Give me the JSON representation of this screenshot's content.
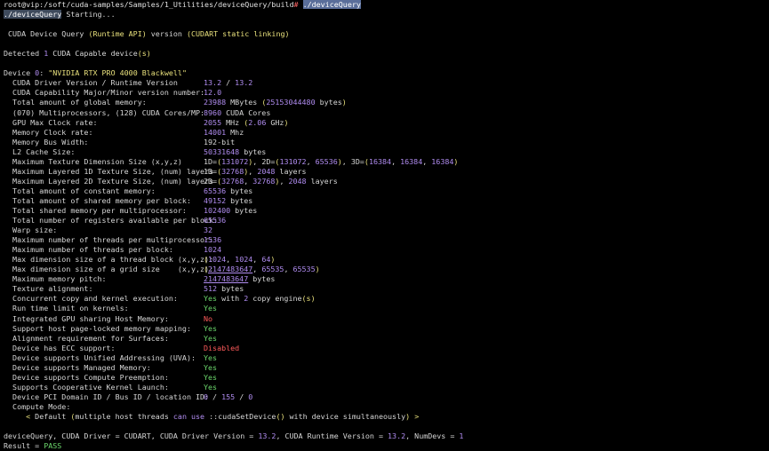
{
  "prompt": {
    "user_host_path": "root@vip:/soft/cuda-samples/Samples/1_Utilities/deviceQuery/build",
    "dollar": "#",
    "command": "./deviceQuery"
  },
  "starting": {
    "path": "./deviceQuery",
    "text": " Starting..."
  },
  "header": {
    "pre": " CUDA Device Query ",
    "paren1": "(Runtime API)",
    "mid": " version ",
    "paren2": "(CUDART static linking)"
  },
  "detected": {
    "pre": "Detected ",
    "count": "1",
    "mid": " CUDA Capable device",
    "suffix": "(s)"
  },
  "device": {
    "pre": "Device ",
    "index": "0",
    "colon": ": ",
    "name": "\"NVIDIA RTX PRO 4000 Blackwell\""
  },
  "rows": [
    {
      "key": "  CUDA Driver Version / Runtime Version",
      "parts": [
        {
          "t": "13.2",
          "c": "num"
        },
        {
          "t": " / ",
          "c": "gray"
        },
        {
          "t": "13.2",
          "c": "num"
        }
      ]
    },
    {
      "key": "  CUDA Capability Major/Minor version number:",
      "parts": [
        {
          "t": "12.0",
          "c": "num"
        }
      ]
    },
    {
      "key": "  Total amount of global memory:",
      "parts": [
        {
          "t": "23988",
          "c": "num"
        },
        {
          "t": " MBytes ",
          "c": "gray"
        },
        {
          "t": "(",
          "c": "paren"
        },
        {
          "t": "25153044480",
          "c": "num"
        },
        {
          "t": " bytes",
          "c": "gray"
        },
        {
          "t": ")",
          "c": "paren"
        }
      ]
    },
    {
      "key": "  (070) Multiprocessors, (128) CUDA Cores/MP:",
      "parts": [
        {
          "t": "8960",
          "c": "num"
        },
        {
          "t": " CUDA Cores",
          "c": "gray"
        }
      ]
    },
    {
      "key": "  GPU Max Clock rate:",
      "parts": [
        {
          "t": "2055",
          "c": "num"
        },
        {
          "t": " MHz ",
          "c": "gray"
        },
        {
          "t": "(",
          "c": "paren"
        },
        {
          "t": "2.06",
          "c": "num"
        },
        {
          "t": " GHz",
          "c": "gray"
        },
        {
          "t": ")",
          "c": "paren"
        }
      ]
    },
    {
      "key": "  Memory Clock rate:",
      "parts": [
        {
          "t": "14001",
          "c": "num"
        },
        {
          "t": " Mhz",
          "c": "gray"
        }
      ]
    },
    {
      "key": "  Memory Bus Width:",
      "parts": [
        {
          "t": "192-bit",
          "c": "gray"
        }
      ]
    },
    {
      "key": "  L2 Cache Size:",
      "parts": [
        {
          "t": "50331648",
          "c": "num"
        },
        {
          "t": " bytes",
          "c": "gray"
        }
      ]
    },
    {
      "key": "  Maximum Texture Dimension Size (x,y,z)",
      "parts": [
        {
          "t": "1D=",
          "c": "gray"
        },
        {
          "t": "(",
          "c": "paren"
        },
        {
          "t": "131072",
          "c": "num"
        },
        {
          "t": ")",
          "c": "paren"
        },
        {
          "t": ", 2D=",
          "c": "gray"
        },
        {
          "t": "(",
          "c": "paren"
        },
        {
          "t": "131072",
          "c": "num"
        },
        {
          "t": ", ",
          "c": "gray"
        },
        {
          "t": "65536",
          "c": "num"
        },
        {
          "t": ")",
          "c": "paren"
        },
        {
          "t": ", 3D=",
          "c": "gray"
        },
        {
          "t": "(",
          "c": "paren"
        },
        {
          "t": "16384",
          "c": "num"
        },
        {
          "t": ", ",
          "c": "gray"
        },
        {
          "t": "16384",
          "c": "num"
        },
        {
          "t": ", ",
          "c": "gray"
        },
        {
          "t": "16384",
          "c": "num"
        },
        {
          "t": ")",
          "c": "paren"
        }
      ]
    },
    {
      "key": "  Maximum Layered 1D Texture Size, (num) layers",
      "parts": [
        {
          "t": "1D=",
          "c": "gray"
        },
        {
          "t": "(",
          "c": "paren"
        },
        {
          "t": "32768",
          "c": "num"
        },
        {
          "t": ")",
          "c": "paren"
        },
        {
          "t": ", ",
          "c": "gray"
        },
        {
          "t": "2048",
          "c": "num"
        },
        {
          "t": " layers",
          "c": "gray"
        }
      ]
    },
    {
      "key": "  Maximum Layered 2D Texture Size, (num) layers",
      "parts": [
        {
          "t": "2D=",
          "c": "gray"
        },
        {
          "t": "(",
          "c": "paren"
        },
        {
          "t": "32768",
          "c": "num"
        },
        {
          "t": ", ",
          "c": "gray"
        },
        {
          "t": "32768",
          "c": "num"
        },
        {
          "t": ")",
          "c": "paren"
        },
        {
          "t": ", ",
          "c": "gray"
        },
        {
          "t": "2048",
          "c": "num"
        },
        {
          "t": " layers",
          "c": "gray"
        }
      ]
    },
    {
      "key": "  Total amount of constant memory:",
      "parts": [
        {
          "t": "65536",
          "c": "num"
        },
        {
          "t": " bytes",
          "c": "gray"
        }
      ]
    },
    {
      "key": "  Total amount of shared memory per block:",
      "parts": [
        {
          "t": "49152",
          "c": "num"
        },
        {
          "t": " bytes",
          "c": "gray"
        }
      ]
    },
    {
      "key": "  Total shared memory per multiprocessor:",
      "parts": [
        {
          "t": "102400",
          "c": "num"
        },
        {
          "t": " bytes",
          "c": "gray"
        }
      ]
    },
    {
      "key": "  Total number of registers available per block:",
      "parts": [
        {
          "t": "65536",
          "c": "num"
        }
      ]
    },
    {
      "key": "  Warp size:",
      "parts": [
        {
          "t": "32",
          "c": "num"
        }
      ]
    },
    {
      "key": "  Maximum number of threads per multiprocessor:",
      "parts": [
        {
          "t": "1536",
          "c": "num"
        }
      ]
    },
    {
      "key": "  Maximum number of threads per block:",
      "parts": [
        {
          "t": "1024",
          "c": "num"
        }
      ]
    },
    {
      "key": "  Max dimension size of a thread block (x,y,z):",
      "parts": [
        {
          "t": "(",
          "c": "paren"
        },
        {
          "t": "1024",
          "c": "num"
        },
        {
          "t": ", ",
          "c": "gray"
        },
        {
          "t": "1024",
          "c": "num"
        },
        {
          "t": ", ",
          "c": "gray"
        },
        {
          "t": "64",
          "c": "num"
        },
        {
          "t": ")",
          "c": "paren"
        }
      ]
    },
    {
      "key": "  Max dimension size of a grid size    (x,y,z):",
      "parts": [
        {
          "t": "(",
          "c": "paren"
        },
        {
          "t": "2147483647",
          "c": "num underline"
        },
        {
          "t": ", ",
          "c": "gray"
        },
        {
          "t": "65535",
          "c": "num"
        },
        {
          "t": ", ",
          "c": "gray"
        },
        {
          "t": "65535",
          "c": "num"
        },
        {
          "t": ")",
          "c": "paren"
        }
      ]
    },
    {
      "key": "  Maximum memory pitch:",
      "parts": [
        {
          "t": "2147483647",
          "c": "num underline"
        },
        {
          "t": " bytes",
          "c": "gray"
        }
      ]
    },
    {
      "key": "  Texture alignment:",
      "parts": [
        {
          "t": "512",
          "c": "num"
        },
        {
          "t": " bytes",
          "c": "gray"
        }
      ]
    },
    {
      "key": "  Concurrent copy and kernel execution:",
      "parts": [
        {
          "t": "Yes",
          "c": "yes"
        },
        {
          "t": " with ",
          "c": "gray"
        },
        {
          "t": "2",
          "c": "num"
        },
        {
          "t": " copy engine",
          "c": "gray"
        },
        {
          "t": "(s)",
          "c": "paren"
        }
      ]
    },
    {
      "key": "  Run time limit on kernels:",
      "parts": [
        {
          "t": "Yes",
          "c": "yes"
        }
      ]
    },
    {
      "key": "  Integrated GPU sharing Host Memory:",
      "parts": [
        {
          "t": "No",
          "c": "no"
        }
      ]
    },
    {
      "key": "  Support host page-locked memory mapping:",
      "parts": [
        {
          "t": "Yes",
          "c": "yes"
        }
      ]
    },
    {
      "key": "  Alignment requirement for Surfaces:",
      "parts": [
        {
          "t": "Yes",
          "c": "yes"
        }
      ]
    },
    {
      "key": "  Device has ECC support:",
      "parts": [
        {
          "t": "Disabled",
          "c": "no"
        }
      ]
    },
    {
      "key": "  Device supports Unified Addressing (UVA):",
      "parts": [
        {
          "t": "Yes",
          "c": "yes"
        }
      ]
    },
    {
      "key": "  Device supports Managed Memory:",
      "parts": [
        {
          "t": "Yes",
          "c": "yes"
        }
      ]
    },
    {
      "key": "  Device supports Compute Preemption:",
      "parts": [
        {
          "t": "Yes",
          "c": "yes"
        }
      ]
    },
    {
      "key": "  Supports Cooperative Kernel Launch:",
      "parts": [
        {
          "t": "Yes",
          "c": "yes"
        }
      ]
    },
    {
      "key": "  Device PCI Domain ID / Bus ID / location ID:",
      "parts": [
        {
          "t": "0",
          "c": "num"
        },
        {
          "t": " / ",
          "c": "gray"
        },
        {
          "t": "155",
          "c": "num"
        },
        {
          "t": " / ",
          "c": "gray"
        },
        {
          "t": "0",
          "c": "num"
        }
      ]
    }
  ],
  "compute_mode": {
    "label": "  Compute Mode:",
    "lt": "     < ",
    "default": "Default",
    "paren_open": " (",
    "desc1": "multiple host threads ",
    "can_use": "can use",
    "desc2": " ::cudaSetDevice",
    "call": "()",
    "desc3": " with device simultaneously",
    "paren_close": ")",
    "gt": " >"
  },
  "summary": {
    "pre": "deviceQuery, CUDA Driver = CUDART, CUDA Driver Version = ",
    "driver_ver": "13.2",
    "mid": ", CUDA Runtime Version = ",
    "runtime_ver": "13.2",
    "mid2": ", NumDevs = ",
    "numdevs": "1"
  },
  "result": {
    "label": "Result = ",
    "value": "PASS"
  },
  "colors": {
    "background": "#000000",
    "text": "#d6d6d6",
    "number": "#b08cf0",
    "paren": "#e8e07c",
    "yes": "#6bd66b",
    "no": "#ff5a5a"
  }
}
